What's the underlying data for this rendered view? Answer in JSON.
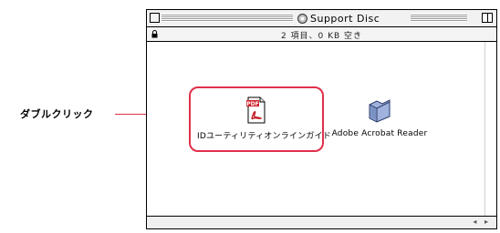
{
  "annotation": {
    "label": "ダブルクリック"
  },
  "window": {
    "title": "Support Disc",
    "info": "2 項目、0 KB 空き"
  },
  "items": [
    {
      "label": "IDユーティリティオンラインガイド",
      "icon": "pdf-document-icon"
    },
    {
      "label": "Adobe Acrobat Reader",
      "icon": "folder-icon"
    }
  ],
  "scroll": {
    "arrows": "◂ ▸"
  },
  "colors": {
    "highlight": "#e0304a",
    "pdf_badge": "#d0202a",
    "folder": "#9fb3dc"
  }
}
